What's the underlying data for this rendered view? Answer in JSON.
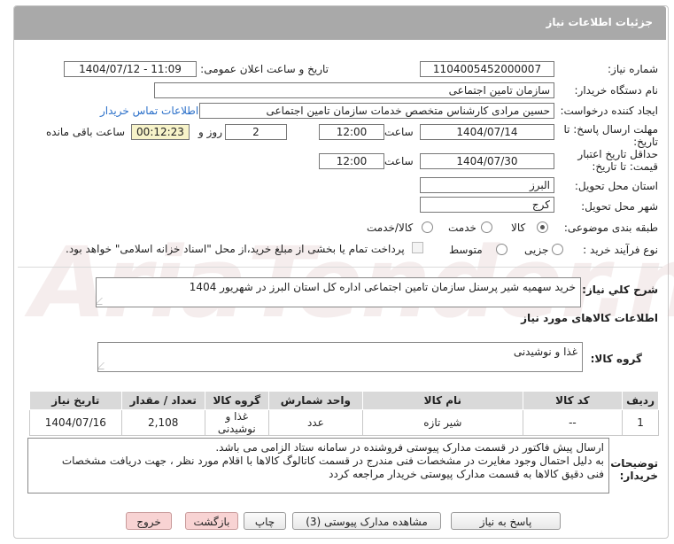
{
  "header": {
    "title": "جزئیات اطلاعات نیاز"
  },
  "watermark": {
    "text": "AriaTender.net"
  },
  "fields": {
    "need_number_label": "شماره نیاز:",
    "need_number": "1104005452000007",
    "announce_label": "تاریخ و ساعت اعلان عمومی:",
    "announce_value": "1404/07/12 - 11:09",
    "buyer_org_label": "نام دستگاه خریدار:",
    "buyer_org": "سازمان تامین اجتماعی",
    "creator_label": "ایجاد کننده درخواست:",
    "creator": "حسین مرادی کارشناس متخصص خدمات سازمان تامین اجتماعی",
    "contact_link": "اطلاعات تماس خریدار",
    "deadline_label_1": "مهلت ارسال پاسخ: تا",
    "deadline_label_2": "تاریخ:",
    "deadline_date": "1404/07/14",
    "time_label": "ساعت",
    "deadline_time": "12:00",
    "days_value": "2",
    "days_label": "روز و",
    "remaining_time": "00:12:23",
    "remaining_label": "ساعت باقی مانده",
    "validity_label_1": "حداقل تاریخ اعتبار",
    "validity_label_2": "قیمت: تا تاریخ:",
    "validity_date": "1404/07/30",
    "validity_time": "12:00",
    "province_label": "استان محل تحویل:",
    "province": "البرز",
    "city_label": "شهر محل تحویل:",
    "city": "کرج",
    "category_label": "طبقه بندی موضوعی:",
    "category_options": [
      "کالا",
      "خدمت",
      "کالا/خدمت"
    ],
    "category_selected": "کالا",
    "process_label": "نوع فرآیند خرید :",
    "process_options": [
      "جزیی",
      "متوسط"
    ],
    "payment_note": "پرداخت تمام یا بخشی از مبلغ خرید،از محل \"اسناد خزانه اسلامی\" خواهد بود."
  },
  "summary": {
    "label": "شرح کلي نیاز:",
    "text": "خرید سهمیه شیر پرسنل سازمان تامین اجتماعی اداره کل استان البرز در شهریور 1404"
  },
  "goods_section": {
    "title": "اطلاعات کالاهای مورد نیاز",
    "group_label": "گروه کالا:",
    "group_value": "غذا و نوشیدنی"
  },
  "table": {
    "headers": [
      "ردیف",
      "کد کالا",
      "نام کالا",
      "واحد شمارش",
      "گروه کالا",
      "تعداد / مقدار",
      "تاریخ نیاز"
    ],
    "rows": [
      [
        "1",
        "--",
        "شیر تازه",
        "عدد",
        "غذا و نوشیدنی",
        "2,108",
        "1404/07/16"
      ]
    ]
  },
  "buyer_notes": {
    "label_1": "توضیحات",
    "label_2": "خریدار:",
    "lines": [
      "ارسال پیش فاکتور در قسمت مدارک پیوستی فروشنده در سامانه ستاد الزامی می باشد.",
      "به دلیل احتمال وجود مغایرت در مشخصات فنی مندرج در قسمت کاتالوگ کالاها با اقلام مورد نظر ، جهت دریافت مشخصات",
      "فنی دقیق کالاها به قسمت مدارک پیوستی خریدار مراجعه کردد"
    ]
  },
  "buttons": {
    "respond": "پاسخ به نیاز",
    "view_docs": "مشاهده مدارک پیوستی (3)",
    "print": "چاپ",
    "back": "بازگشت",
    "exit": "خروج"
  }
}
